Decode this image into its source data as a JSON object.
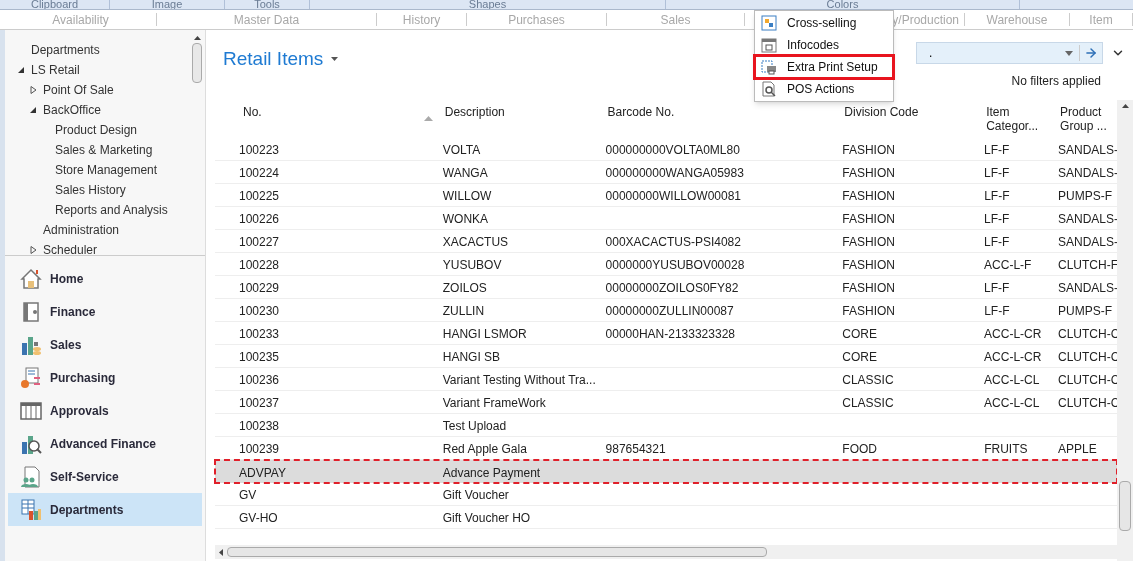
{
  "ribbon_groups": [
    {
      "label": "Clipboard"
    },
    {
      "label": "Image"
    },
    {
      "label": "Tools"
    },
    {
      "label": "Shapes"
    },
    {
      "label": "Colors"
    }
  ],
  "ribbon_tabs": [
    {
      "label": "Availability"
    },
    {
      "label": "Master Data"
    },
    {
      "label": "History"
    },
    {
      "label": "Purchases"
    },
    {
      "label": "Sales"
    },
    {
      "label": "y/Production"
    },
    {
      "label": "Warehouse"
    },
    {
      "label": "Item"
    }
  ],
  "action_menu": [
    {
      "label": "Cross-selling",
      "selected": false
    },
    {
      "label": "Infocodes",
      "selected": false
    },
    {
      "label": "Extra Print Setup",
      "selected": true
    },
    {
      "label": "POS Actions",
      "selected": false
    }
  ],
  "nav_tree": [
    {
      "label": "Departments"
    },
    {
      "label": "LS Retail",
      "expanded": true,
      "children": [
        {
          "label": "Point Of Sale",
          "expanded": false
        },
        {
          "label": "BackOffice",
          "expanded": true,
          "children": [
            {
              "label": "Product Design"
            },
            {
              "label": "Sales & Marketing"
            },
            {
              "label": "Store Management"
            },
            {
              "label": "Sales History"
            },
            {
              "label": "Reports and Analysis"
            }
          ]
        },
        {
          "label": "Administration"
        },
        {
          "label": "Scheduler",
          "expanded": false
        }
      ]
    }
  ],
  "nav_buttons": [
    {
      "label": "Home",
      "selected": false
    },
    {
      "label": "Finance",
      "selected": false
    },
    {
      "label": "Sales",
      "selected": false
    },
    {
      "label": "Purchasing",
      "selected": false
    },
    {
      "label": "Approvals",
      "selected": false
    },
    {
      "label": "Advanced Finance",
      "selected": false
    },
    {
      "label": "Self-Service",
      "selected": false
    },
    {
      "label": "Departments",
      "selected": true
    }
  ],
  "page_title": "Retail Items",
  "filter_field": {
    "value": "."
  },
  "filter_status": "No filters applied",
  "table": {
    "columns": [
      {
        "label": "No.",
        "sorted": true
      },
      {
        "label": "Description",
        "sorted": false
      },
      {
        "label": "Barcode No.",
        "sorted": false
      },
      {
        "label": "Division Code",
        "sorted": false
      },
      {
        "label": "Item Categor...",
        "sorted": false
      },
      {
        "label": "Product Group ...",
        "sorted": false
      }
    ],
    "rows": [
      {
        "selected": false,
        "cells": [
          "100223",
          "VOLTA",
          "000000000VOLTA0ML80",
          "FASHION",
          "LF-F",
          "SANDALS-"
        ]
      },
      {
        "selected": false,
        "cells": [
          "100224",
          "WANGA",
          "000000000WANGA05983",
          "FASHION",
          "LF-F",
          "SANDALS-"
        ]
      },
      {
        "selected": false,
        "cells": [
          "100225",
          "WILLOW",
          "00000000WILLOW00081",
          "FASHION",
          "LF-F",
          "PUMPS-F"
        ]
      },
      {
        "selected": false,
        "cells": [
          "100226",
          "WONKA",
          "",
          "FASHION",
          "LF-F",
          "SANDALS-"
        ]
      },
      {
        "selected": false,
        "cells": [
          "100227",
          "XACACTUS",
          "000XACACTUS-PSI4082",
          "FASHION",
          "LF-F",
          "SANDALS-"
        ]
      },
      {
        "selected": false,
        "cells": [
          "100228",
          "YUSUBOV",
          "0000000YUSUBOV00028",
          "FASHION",
          "ACC-L-F",
          "CLUTCH-F"
        ]
      },
      {
        "selected": false,
        "cells": [
          "100229",
          "ZOILOS",
          "00000000ZOILOS0FY82",
          "FASHION",
          "LF-F",
          "SANDALS-"
        ]
      },
      {
        "selected": false,
        "cells": [
          "100230",
          "ZULLIN",
          "00000000ZULLIN00087",
          "FASHION",
          "LF-F",
          "PUMPS-F"
        ]
      },
      {
        "selected": false,
        "cells": [
          "100233",
          "HANGI LSMOR",
          "00000HAN-2133323328",
          "CORE",
          "ACC-L-CR",
          "CLUTCH-C"
        ]
      },
      {
        "selected": false,
        "cells": [
          "100235",
          "HANGI SB",
          "",
          "CORE",
          "ACC-L-CR",
          "CLUTCH-C"
        ]
      },
      {
        "selected": false,
        "cells": [
          "100236",
          "Variant Testing Without Tra...",
          "",
          "CLASSIC",
          "ACC-L-CL",
          "CLUTCH-C"
        ]
      },
      {
        "selected": false,
        "cells": [
          "100237",
          "Variant FrameWork",
          "",
          "CLASSIC",
          "ACC-L-CL",
          "CLUTCH-C"
        ]
      },
      {
        "selected": false,
        "cells": [
          "100238",
          "Test Upload",
          "",
          "",
          "",
          ""
        ]
      },
      {
        "selected": false,
        "cells": [
          "100239",
          "Red Apple Gala",
          "987654321",
          "FOOD",
          "FRUITS",
          "APPLE"
        ]
      },
      {
        "selected": true,
        "cells": [
          "ADVPAY",
          "Advance Payment",
          "",
          "",
          "",
          ""
        ]
      },
      {
        "selected": false,
        "cells": [
          "GV",
          "Gift Voucher",
          "",
          "",
          "",
          ""
        ]
      },
      {
        "selected": false,
        "cells": [
          "GV-HO",
          "Gift Voucher HO",
          "",
          "",
          "",
          ""
        ]
      }
    ]
  }
}
